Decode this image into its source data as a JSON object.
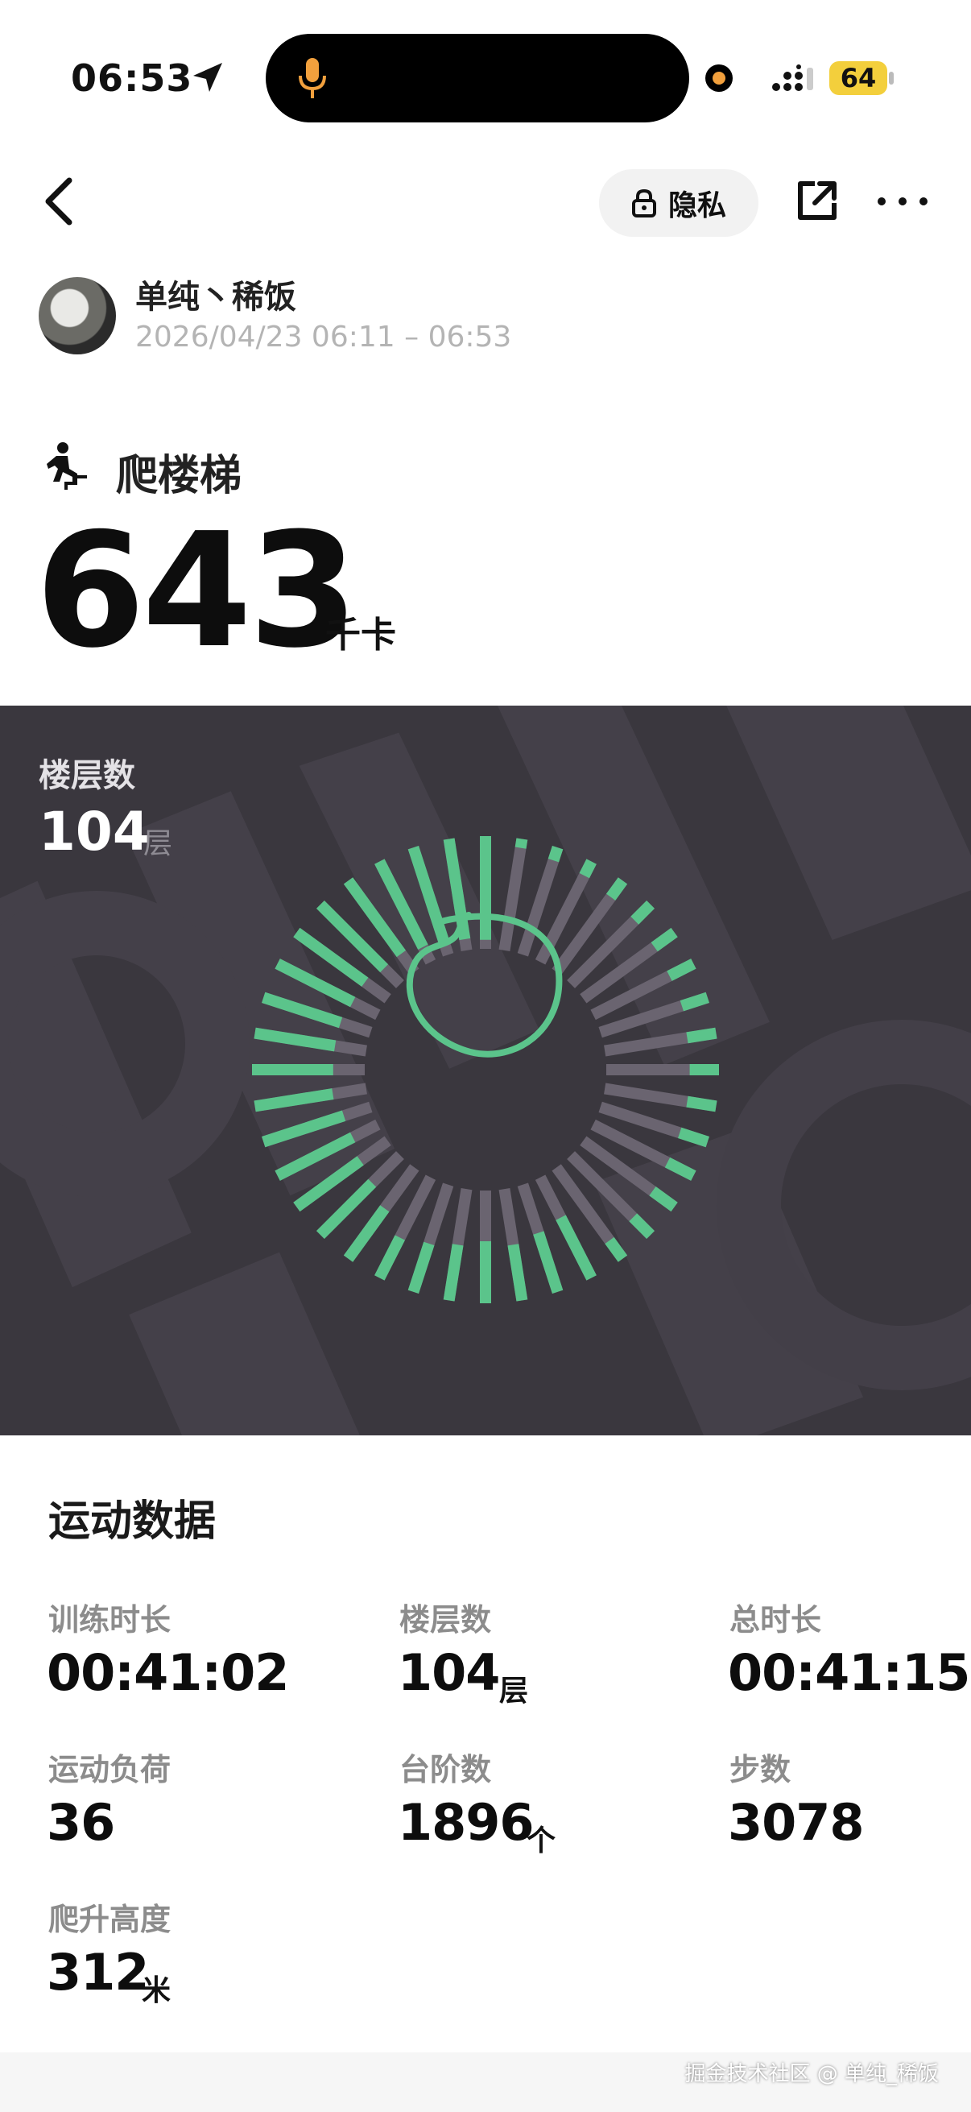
{
  "status_bar": {
    "time": "06:53",
    "battery": "64",
    "icons": [
      "location-arrow-icon",
      "microphone-icon",
      "signal-icon"
    ]
  },
  "header": {
    "privacy_label": "隐私",
    "icons": [
      "back-arrow-icon",
      "lock-icon",
      "share-icon",
      "more-icon"
    ]
  },
  "user": {
    "name": "单纯丶稀饭",
    "time_range": "2026/04/23 06:11 – 06:53"
  },
  "activity": {
    "name": "爬楼梯",
    "calories": "643",
    "calories_unit": "千卡",
    "icon": "stair-climb-icon"
  },
  "panel": {
    "floors_label": "楼层数",
    "floors_value": "104",
    "floors_unit": "层",
    "colors": {
      "background": "#3a373e",
      "bar_fill": "#5bc48b",
      "bar_track": "#6a6470"
    },
    "ring_fill_fractions": [
      0.92,
      0.08,
      0.12,
      0.14,
      0.18,
      0.2,
      0.22,
      0.24,
      0.24,
      0.26,
      0.26,
      0.26,
      0.26,
      0.26,
      0.24,
      0.22,
      0.2,
      0.6,
      0.55,
      0.5,
      0.55,
      0.5,
      0.45,
      0.4,
      0.55,
      0.65,
      0.7,
      0.75,
      0.75,
      0.7,
      0.72,
      0.72,
      0.72,
      0.75,
      0.75,
      0.8,
      0.8,
      0.85,
      0.88,
      0.9
    ]
  },
  "stats": {
    "title": "运动数据",
    "items": [
      {
        "label": "训练时长",
        "value": "00:41:02",
        "unit": ""
      },
      {
        "label": "楼层数",
        "value": "104",
        "unit": "层"
      },
      {
        "label": "总时长",
        "value": "00:41:15",
        "unit": ""
      },
      {
        "label": "运动负荷",
        "value": "36",
        "unit": ""
      },
      {
        "label": "台阶数",
        "value": "1896",
        "unit": "个"
      },
      {
        "label": "步数",
        "value": "3078",
        "unit": ""
      },
      {
        "label": "爬升高度",
        "value": "312",
        "unit": "米"
      }
    ]
  },
  "watermark": "掘金技术社区 @ 单纯_稀饭"
}
